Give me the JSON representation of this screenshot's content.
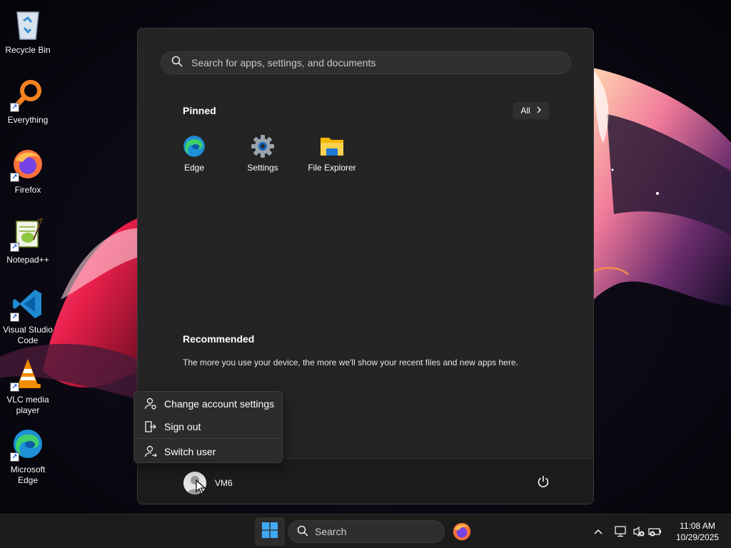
{
  "desktop": {
    "icons": [
      {
        "label": "Recycle Bin"
      },
      {
        "label": "Everything"
      },
      {
        "label": "Firefox"
      },
      {
        "label": "Notepad++"
      },
      {
        "label": "Visual Studio Code"
      },
      {
        "label": "VLC media player"
      },
      {
        "label": "Microsoft Edge"
      }
    ]
  },
  "start_menu": {
    "search_placeholder": "Search for apps, settings, and documents",
    "pinned_title": "Pinned",
    "all_label": "All",
    "pinned_apps": [
      {
        "label": "Edge",
        "icon": "edge-icon"
      },
      {
        "label": "Settings",
        "icon": "gear-icon"
      },
      {
        "label": "File Explorer",
        "icon": "folder-icon"
      }
    ],
    "recommended_title": "Recommended",
    "recommended_text": "The more you use your device, the more we'll show your recent files and new apps here.",
    "user_name": "VM6"
  },
  "account_menu": {
    "items": [
      {
        "label": "Change account settings",
        "icon": "account-settings-icon"
      },
      {
        "label": "Sign out",
        "icon": "sign-out-icon"
      },
      {
        "label": "Switch user",
        "icon": "switch-user-icon"
      }
    ]
  },
  "taskbar": {
    "search_label": "Search",
    "time": "11:08 AM",
    "date": "10/29/2025"
  },
  "colors": {
    "menu_background": "#242424",
    "taskbar_background": "#1c1c1c",
    "accent_blue": "#0078d4"
  }
}
